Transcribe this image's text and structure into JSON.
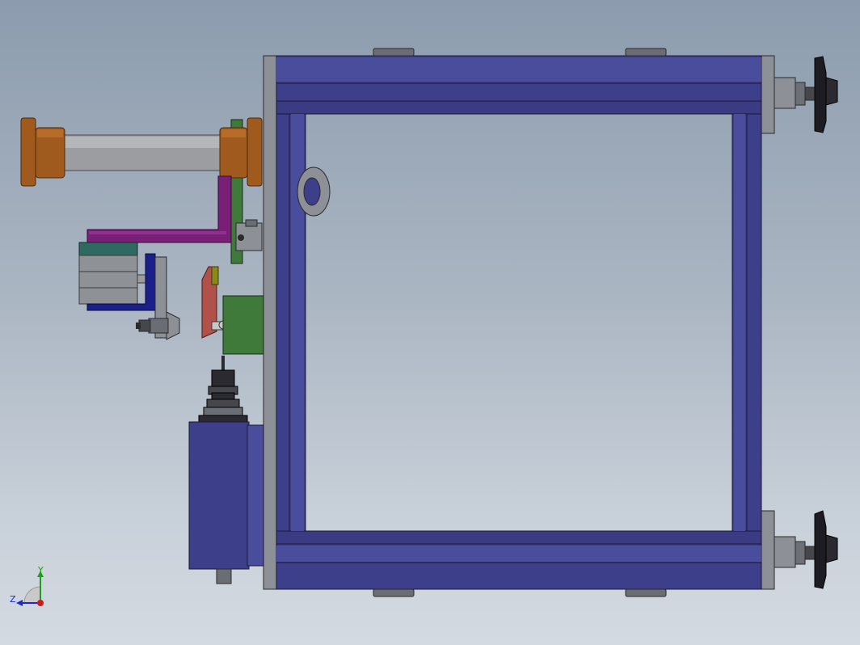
{
  "view": {
    "type": "CAD model view (front / side projection)"
  },
  "triad": {
    "labels": {
      "y": "Y",
      "z": "Z"
    },
    "colors": {
      "y": "#1aa01a",
      "z": "#1a2ad0",
      "x": "#d01a1a"
    }
  },
  "colors": {
    "frame_blue": "#3e3f8a",
    "frame_blue_light": "#4a4c9c",
    "frame_outline": "#1a1a33",
    "plate_gray": "#8d9096",
    "roller_orange": "#a05a1e",
    "roller_shaft": "#9b9da1",
    "bracket_magenta": "#7a1f78",
    "plate_green": "#3f7a3a",
    "cylinder_gray": "#8e9196",
    "bracket_navy": "#1a1f8a",
    "pin_red": "#b0524a",
    "tab_olive": "#8a8a1a",
    "knob_black": "#1c1c22"
  }
}
